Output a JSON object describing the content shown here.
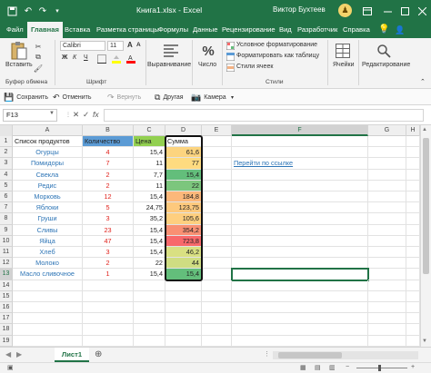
{
  "titlebar": {
    "doc_title": "Книга1.xlsx - Excel",
    "user_name": "Виктор Бухтеев",
    "avatar_glyph": "♟",
    "save_icon": "save-icon",
    "undo_icon": "undo-icon",
    "redo_icon": "redo-icon",
    "customize_icon": "customize-icon"
  },
  "tabs": [
    "Файл",
    "Главная",
    "Вставка",
    "Разметка страницы",
    "Формулы",
    "Данные",
    "Рецензирование",
    "Вид",
    "Разработчик",
    "Справка"
  ],
  "active_tab": "Главная",
  "ribbon": {
    "paste_label": "Вставить",
    "clipboard_group": "Буфер обмена",
    "font_name": "Calibri",
    "font_size": "11",
    "font_group": "Шрифт",
    "bold": "Ж",
    "italic": "К",
    "underline": "Ч",
    "align_label": "Выравнивание",
    "number_label": "Число",
    "conditional_formatting": "Условное форматирование",
    "format_as_table": "Форматировать как таблицу",
    "cell_styles": "Стили ячеек",
    "styles_group": "Стили",
    "cells_label": "Ячейки",
    "editing_label": "Редактирование"
  },
  "quickbar": {
    "save": "Сохранить",
    "undo": "Отменить",
    "redo": "Вернуть",
    "other": "Другая",
    "camera": "Камера"
  },
  "formula": {
    "namebox": "F13",
    "cancel": "✕",
    "enter": "✓",
    "fx": "fx",
    "value": ""
  },
  "columns": [
    "A",
    "B",
    "C",
    "D",
    "E",
    "F",
    "G",
    "H"
  ],
  "selected_column": "F",
  "selected_row": 13,
  "table": {
    "headers": [
      "Список продуктов",
      "Количество",
      "Цена",
      "Сумма"
    ],
    "rows": [
      {
        "product": "Огурцы",
        "qty": "4",
        "price": "15,4",
        "sum": "61,6",
        "color": "#fcd47f"
      },
      {
        "product": "Помидоры",
        "qty": "7",
        "price": "11",
        "sum": "77",
        "color": "#fedb80"
      },
      {
        "product": "Свекла",
        "qty": "2",
        "price": "7,7",
        "sum": "15,4",
        "color": "#63be7b"
      },
      {
        "product": "Редис",
        "qty": "2",
        "price": "11",
        "sum": "22",
        "color": "#7cc67d"
      },
      {
        "product": "Морковь",
        "qty": "12",
        "price": "15,4",
        "sum": "184,8",
        "color": "#fcb87a"
      },
      {
        "product": "Яблоки",
        "qty": "5",
        "price": "24,75",
        "sum": "123,75",
        "color": "#fdc97d"
      },
      {
        "product": "Груши",
        "qty": "3",
        "price": "35,2",
        "sum": "105,6",
        "color": "#fecf7f"
      },
      {
        "product": "Сливы",
        "qty": "23",
        "price": "15,4",
        "sum": "354,2",
        "color": "#f99073"
      },
      {
        "product": "Яйца",
        "qty": "47",
        "price": "15,4",
        "sum": "723,8",
        "color": "#f8696b"
      },
      {
        "product": "Хлеб",
        "qty": "3",
        "price": "15,4",
        "sum": "46,2",
        "color": "#d9e082"
      },
      {
        "product": "Молоко",
        "qty": "2",
        "price": "22",
        "sum": "44",
        "color": "#cfdd82"
      },
      {
        "product": "Масло сливочное",
        "qty": "1",
        "price": "15,4",
        "sum": "15,4",
        "color": "#63be7b"
      }
    ]
  },
  "link_text": "Перейти по ссылке",
  "row_numbers": [
    "1",
    "2",
    "3",
    "4",
    "5",
    "6",
    "7",
    "8",
    "9",
    "10",
    "11",
    "12",
    "13",
    "14",
    "15",
    "16",
    "17",
    "18",
    "19"
  ],
  "sheet": {
    "name": "Лист1",
    "add": "⊕"
  },
  "colors": {
    "accent": "#217346",
    "price_header": "#92d050",
    "qty_header": "#5b9bd5",
    "product_text": "#2e75b6",
    "qty_text": "#e0201a",
    "link": "#2e75b6"
  }
}
